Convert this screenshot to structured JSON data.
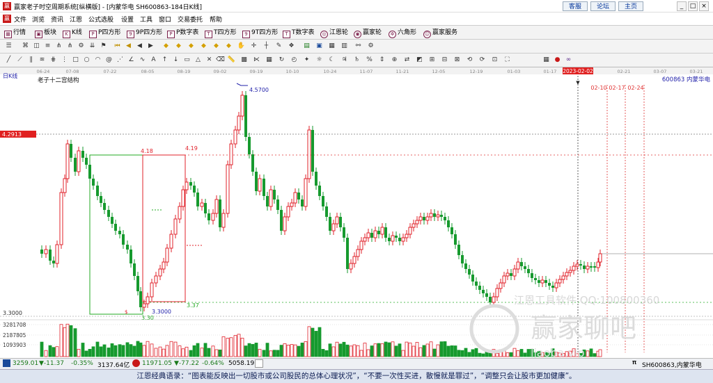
{
  "window": {
    "title": "赢家老子时空周期系统[纵横版] - [内蒙华电  SH600863-184日K线]",
    "links": [
      "客服",
      "论坛",
      "主页"
    ],
    "controls": [
      "_",
      "□",
      "×"
    ]
  },
  "menu": [
    "文件",
    "浏览",
    "资讯",
    "江恩",
    "公式选股",
    "设置",
    "工具",
    "窗口",
    "交易委托",
    "帮助"
  ],
  "toolbar1": [
    {
      "label": "行情",
      "icon": "grid-icon"
    },
    {
      "label": "板块",
      "icon": "blocks-icon"
    },
    {
      "label": "K线",
      "icon": "kline-icon"
    },
    {
      "label": "P四方形",
      "icon": "p-square-icon"
    },
    {
      "label": "9P四方形",
      "icon": "9p-square-icon"
    },
    {
      "label": "P数字表",
      "icon": "p-table-icon"
    },
    {
      "label": "T四方形",
      "icon": "t-square-icon"
    },
    {
      "label": "9T四方形",
      "icon": "9t-square-icon"
    },
    {
      "label": "T数字表",
      "icon": "t-table-icon"
    },
    {
      "label": "江恩轮",
      "icon": "gann-wheel-icon"
    },
    {
      "label": "赢家轮",
      "icon": "winner-wheel-icon"
    },
    {
      "label": "六角形",
      "icon": "hexagon-icon"
    },
    {
      "label": "赢家服务",
      "icon": "service-icon"
    }
  ],
  "chart": {
    "period_label": "日K线",
    "indicator_title": "老子十二宫结构",
    "stock_label": "600863  内蒙华电",
    "date_axis": [
      "06-24",
      "07-08",
      "07-22",
      "08-05",
      "08-19",
      "09-02",
      "09-19",
      "10-10",
      "10-24",
      "11-07",
      "11-21",
      "12-05",
      "12-19",
      "01-03",
      "01-17",
      "2023-02-02",
      "02-21",
      "03-07",
      "03-21"
    ],
    "highlight_date": "2023-02-02",
    "future_dates": [
      "02-10",
      "02-17",
      "02-24"
    ],
    "price_tag": "4.2913",
    "high_label": "4.5700",
    "low_label": "3.3000",
    "low_label_short": "3.30",
    "box_label_top_left": "4.18",
    "box_label_top_right": "4.19",
    "box_label_bottom": "3.37",
    "price_axis_low": "3.3000",
    "volume_axis": [
      "3281708",
      "2187805",
      "1093903"
    ],
    "watermark_lines": [
      "江恩工具软件  QQ:100800360",
      "赢家聊吧",
      "ljaoba.vip"
    ],
    "colors": {
      "up": "#e0202a",
      "down": "#169a2e",
      "box_green": "#22aa22",
      "box_red": "#e0202a",
      "ref_red": "#e03030",
      "ref_gray": "#999999",
      "blue_label": "#2222aa"
    }
  },
  "status": {
    "sh_index": "3259.01",
    "sh_change": "▼-11.37",
    "sh_pct": "-0.35%",
    "sh_amount": "3137.64亿",
    "sz_index": "11971.05",
    "sz_change": "▼-77.22",
    "sz_pct": "-0.64%",
    "sz_amount": "5058.19",
    "right_code": "SH600863,内蒙华电"
  },
  "quote": "江恩经典语录：“图表能反映出一切股市或公司股民的总体心理状况”，“不要一次性买进，散慢就是罪过”，“调整只会让股市更加健康”。"
}
